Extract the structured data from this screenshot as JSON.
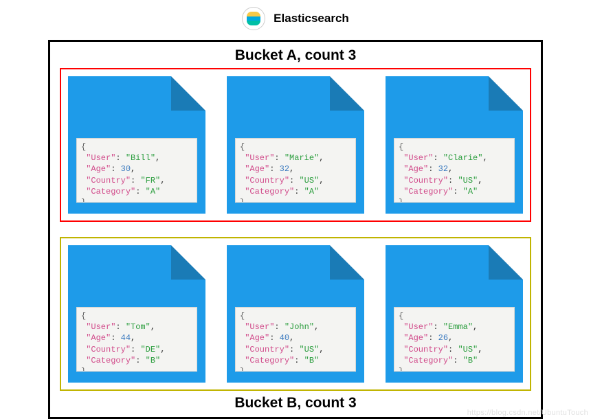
{
  "brand": "Elasticsearch",
  "bucketA": {
    "title": "Bucket A, count 3",
    "docs": [
      {
        "user": "Bill",
        "age": 30,
        "country": "FR",
        "category": "A"
      },
      {
        "user": "Marie",
        "age": 32,
        "country": "US",
        "category": "A"
      },
      {
        "user": "Clarie",
        "age": 32,
        "country": "US",
        "category": "A"
      }
    ]
  },
  "bucketB": {
    "title": "Bucket B, count 3",
    "docs": [
      {
        "user": "Tom",
        "age": 44,
        "country": "DE",
        "category": "B"
      },
      {
        "user": "John",
        "age": 40,
        "country": "US",
        "category": "B"
      },
      {
        "user": "Emma",
        "age": 26,
        "country": "US",
        "category": "B"
      }
    ]
  },
  "keys": {
    "user": "User",
    "age": "Age",
    "country": "Country",
    "category": "Category"
  },
  "watermark": "https://blog.csdn.net/UbuntuTouch"
}
